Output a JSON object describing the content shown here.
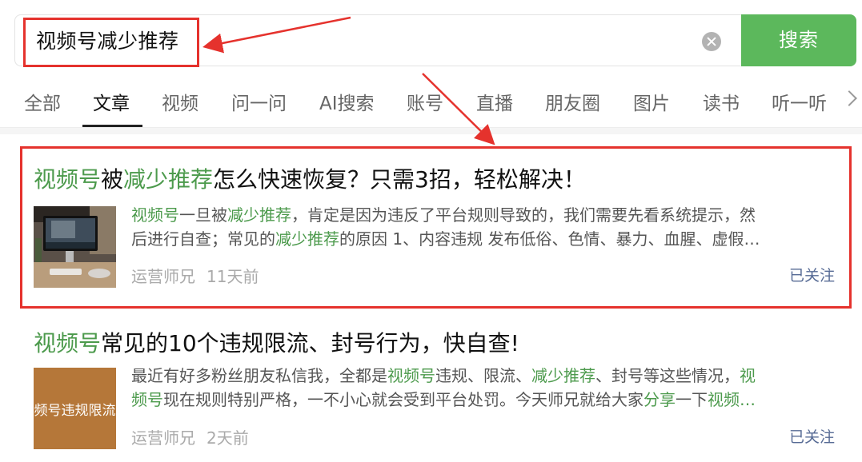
{
  "search": {
    "query": "视频号减少推荐",
    "button_label": "搜索"
  },
  "tabs": [
    {
      "label": "全部"
    },
    {
      "label": "文章",
      "active": true
    },
    {
      "label": "视频"
    },
    {
      "label": "问一问"
    },
    {
      "label": "AI搜索"
    },
    {
      "label": "账号"
    },
    {
      "label": "直播"
    },
    {
      "label": "朋友圈"
    },
    {
      "label": "图片"
    },
    {
      "label": "读书"
    },
    {
      "label": "听一听"
    }
  ],
  "results": [
    {
      "title_parts": [
        "视频号",
        "被",
        "减少推荐",
        "怎么快速恢复？只需3招，轻松解决！"
      ],
      "snippet_line1_parts": [
        "视频号",
        "一旦被",
        "减少推荐",
        "，肯定是因为违反了平台规则导致的，我们需要先看系统提示，然"
      ],
      "snippet_line2_parts": [
        "后进行自查；常见的",
        "减少推荐",
        "的原因 1、内容违规 发布低俗、色情、暴力、血腥、虚假…"
      ],
      "author": "运营师兄",
      "time": "11天前",
      "follow_label": "已关注"
    },
    {
      "title_parts": [
        "视频号",
        "常见的10个违规限流、封号行为，快自查!"
      ],
      "snippet_line1_parts": [
        "最近有好多粉丝朋友私信我，全都是",
        "视频号",
        "违规、限流、",
        "减少推荐",
        "、封号等这些情况，",
        "视"
      ],
      "snippet_line2_parts": [
        "频号",
        "现在规则特别严格，一不小心就会受到平台处罚。今天师兄就给大家",
        "分享",
        "一下",
        "视频…"
      ],
      "thumbnail_text": "频号违规限流",
      "author": "运营师兄",
      "time": "2天前",
      "follow_label": "已关注"
    }
  ],
  "colors": {
    "accent_green": "#5cb85c",
    "highlight_green": "#4c9a4c",
    "annotation_red": "#e5322d",
    "follow_blue": "#576b95"
  }
}
